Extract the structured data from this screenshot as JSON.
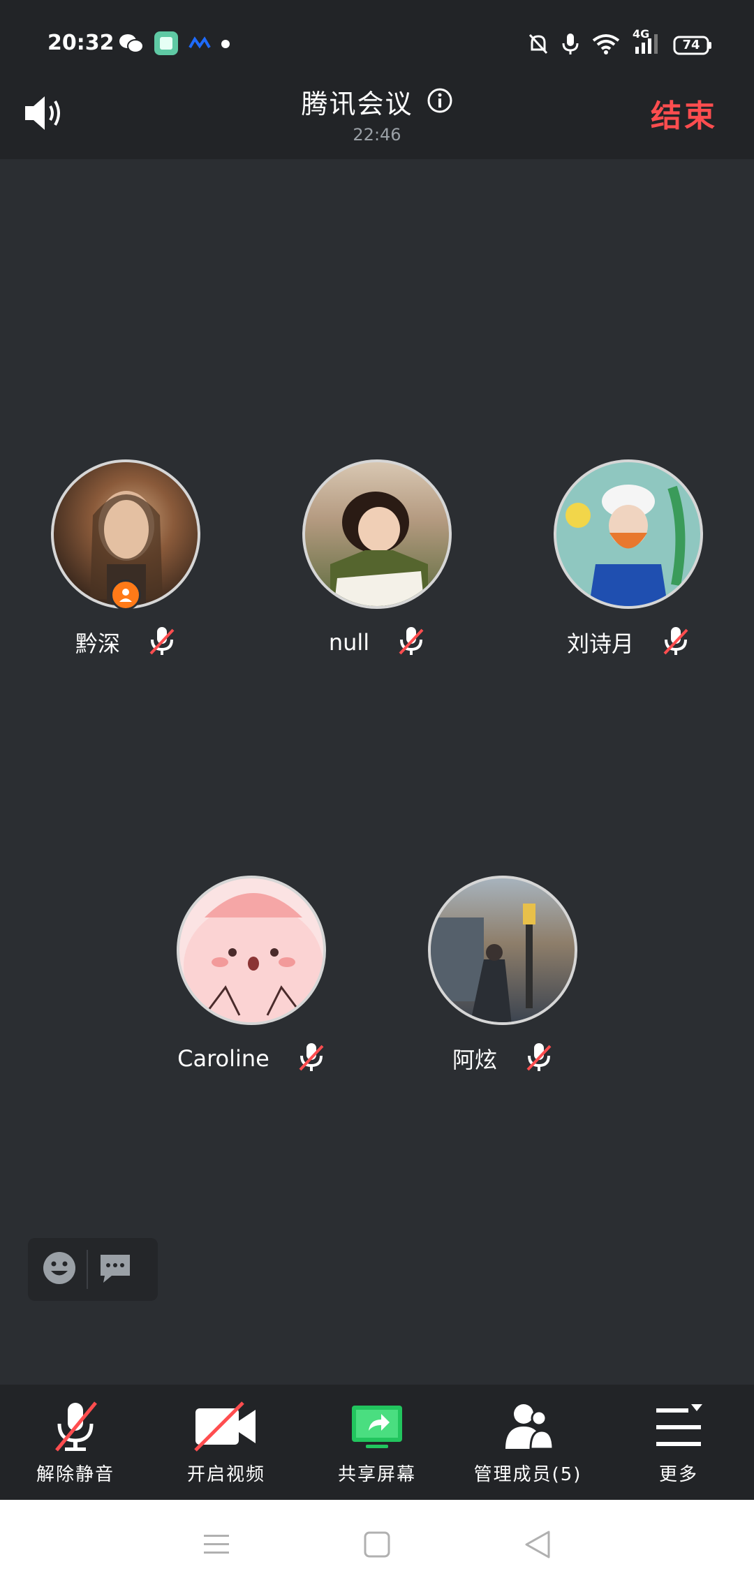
{
  "status_bar": {
    "time": "20:32",
    "network": "4G",
    "battery": "74",
    "left_icons": [
      "wechat-icon",
      "app-icon",
      "meta-icon",
      "dot-icon"
    ],
    "right_icons": [
      "mute-bell-icon",
      "mic-icon",
      "wifi-icon",
      "signal-icon",
      "battery-icon"
    ]
  },
  "header": {
    "title": "腾讯会议",
    "timer": "22:46",
    "end_label": "结束"
  },
  "participants": [
    {
      "name": "黔深",
      "muted": true,
      "host": true
    },
    {
      "name": "null",
      "muted": true,
      "host": false
    },
    {
      "name": "刘诗月",
      "muted": true,
      "host": false
    },
    {
      "name": "Caroline",
      "muted": true,
      "host": false
    },
    {
      "name": "阿炫",
      "muted": true,
      "host": false
    }
  ],
  "toolbar": {
    "unmute": "解除静音",
    "video": "开启视频",
    "share": "共享屏幕",
    "members": "管理成员(5)",
    "more": "更多"
  },
  "colors": {
    "background": "#2b2e32",
    "bar": "#222427",
    "end": "#ff4d4f",
    "share": "#22c55e",
    "host_badge": "#ff7a18"
  }
}
